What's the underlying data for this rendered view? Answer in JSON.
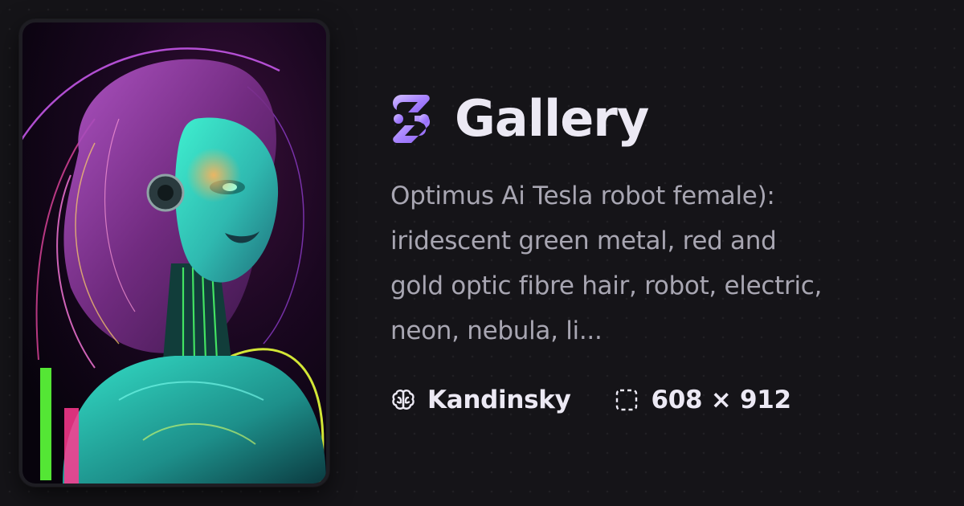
{
  "brand": {
    "title": "Gallery",
    "logo_icon": "puzzle-s-logo-icon",
    "accent_color": "#b9a1ff"
  },
  "artwork": {
    "description_lines": [
      "Optimus Ai Tesla robot female):",
      "iridescent green metal, red and",
      "gold optic fibre hair, robot, electric,",
      "neon, nebula, li..."
    ],
    "model": "Kandinsky",
    "model_icon": "brain-icon",
    "dimensions": "608 × 912",
    "dimensions_icon": "dashed-frame-icon"
  }
}
